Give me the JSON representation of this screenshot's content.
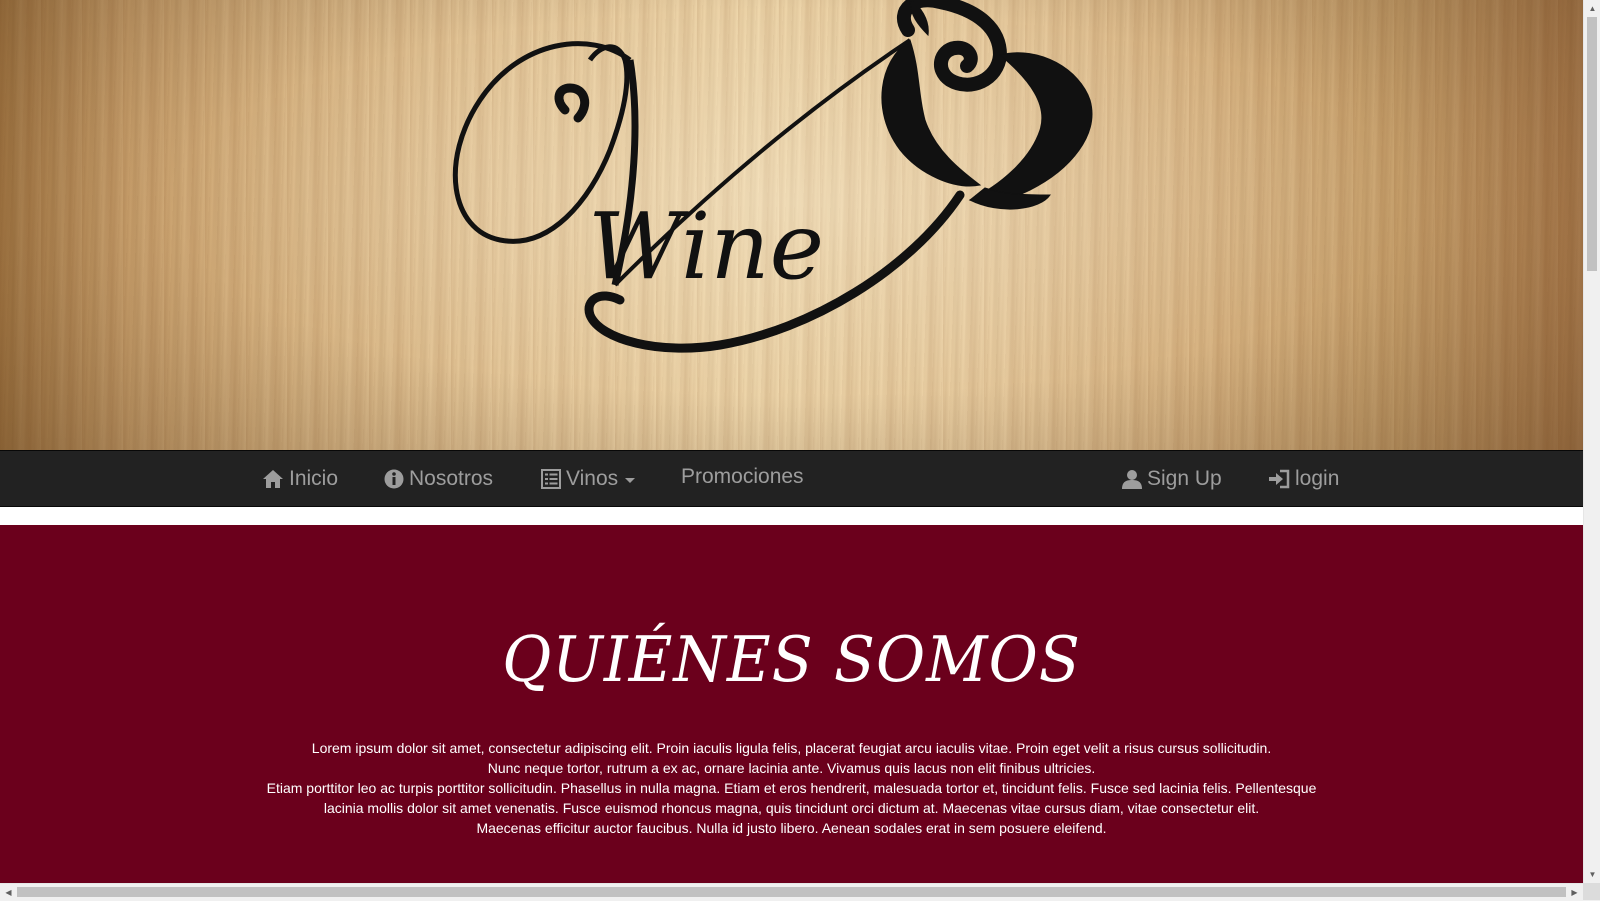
{
  "logo": {
    "wordmark": "Wine",
    "colors": {
      "ink": "#111111"
    }
  },
  "navbar": {
    "items": [
      {
        "label": "Inicio",
        "icon": "home-icon"
      },
      {
        "label": "Nosotros",
        "icon": "info-sign-icon"
      },
      {
        "label": "Vinos",
        "icon": "list-alt-icon",
        "dropdown": true
      },
      {
        "label": "Promociones"
      }
    ],
    "right_items": [
      {
        "label": "Sign Up",
        "icon": "user-icon"
      },
      {
        "label": "login",
        "icon": "log-in-icon"
      }
    ],
    "colors": {
      "background": "#222222",
      "text": "#9d9d9d"
    }
  },
  "about": {
    "title": "QUIÉNES SOMOS",
    "lines": [
      "Lorem ipsum dolor sit amet, consectetur adipiscing elit. Proin iaculis ligula felis, placerat feugiat arcu iaculis vitae. Proin eget velit a risus cursus sollicitudin.",
      "Nunc neque tortor, rutrum a ex ac, ornare lacinia ante. Vivamus quis lacus non elit finibus ultricies.",
      "Etiam porttitor leo ac turpis porttitor sollicitudin. Phasellus in nulla magna. Etiam et eros hendrerit, malesuada tortor et, tincidunt felis. Fusce sed lacinia felis. Pellentesque lacinia mollis dolor sit amet venenatis. Fusce euismod rhoncus magna, quis tincidunt orci dictum at. Maecenas vitae cursus diam, vitae consectetur elit.",
      "Maecenas efficitur auctor faucibus. Nulla id justo libero. Aenean sodales erat in sem posuere eleifend."
    ],
    "colors": {
      "background": "#6b001c",
      "text": "#ffffff"
    }
  }
}
